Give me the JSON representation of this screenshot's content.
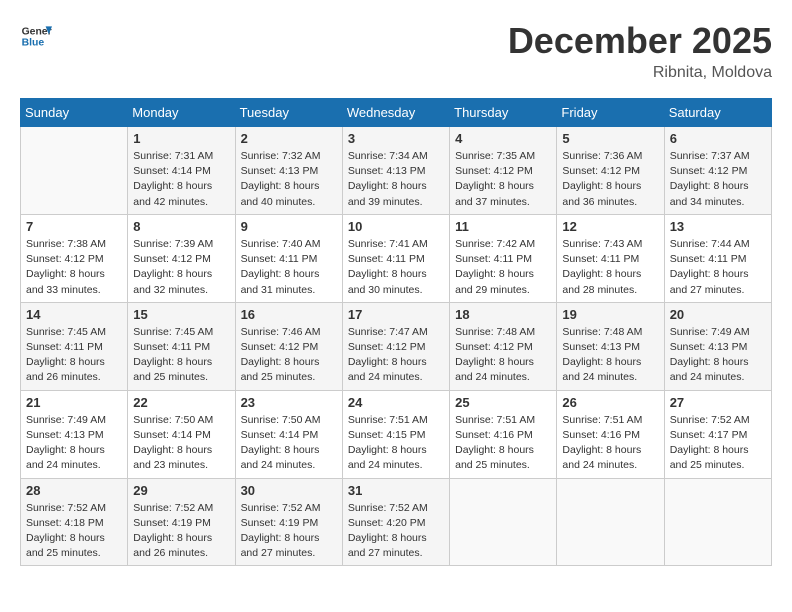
{
  "header": {
    "logo_line1": "General",
    "logo_line2": "Blue",
    "month_year": "December 2025",
    "location": "Ribnita, Moldova"
  },
  "weekdays": [
    "Sunday",
    "Monday",
    "Tuesday",
    "Wednesday",
    "Thursday",
    "Friday",
    "Saturday"
  ],
  "weeks": [
    [
      {
        "day": "",
        "sunrise": "",
        "sunset": "",
        "daylight": ""
      },
      {
        "day": "1",
        "sunrise": "Sunrise: 7:31 AM",
        "sunset": "Sunset: 4:14 PM",
        "daylight": "Daylight: 8 hours and 42 minutes."
      },
      {
        "day": "2",
        "sunrise": "Sunrise: 7:32 AM",
        "sunset": "Sunset: 4:13 PM",
        "daylight": "Daylight: 8 hours and 40 minutes."
      },
      {
        "day": "3",
        "sunrise": "Sunrise: 7:34 AM",
        "sunset": "Sunset: 4:13 PM",
        "daylight": "Daylight: 8 hours and 39 minutes."
      },
      {
        "day": "4",
        "sunrise": "Sunrise: 7:35 AM",
        "sunset": "Sunset: 4:12 PM",
        "daylight": "Daylight: 8 hours and 37 minutes."
      },
      {
        "day": "5",
        "sunrise": "Sunrise: 7:36 AM",
        "sunset": "Sunset: 4:12 PM",
        "daylight": "Daylight: 8 hours and 36 minutes."
      },
      {
        "day": "6",
        "sunrise": "Sunrise: 7:37 AM",
        "sunset": "Sunset: 4:12 PM",
        "daylight": "Daylight: 8 hours and 34 minutes."
      }
    ],
    [
      {
        "day": "7",
        "sunrise": "Sunrise: 7:38 AM",
        "sunset": "Sunset: 4:12 PM",
        "daylight": "Daylight: 8 hours and 33 minutes."
      },
      {
        "day": "8",
        "sunrise": "Sunrise: 7:39 AM",
        "sunset": "Sunset: 4:12 PM",
        "daylight": "Daylight: 8 hours and 32 minutes."
      },
      {
        "day": "9",
        "sunrise": "Sunrise: 7:40 AM",
        "sunset": "Sunset: 4:11 PM",
        "daylight": "Daylight: 8 hours and 31 minutes."
      },
      {
        "day": "10",
        "sunrise": "Sunrise: 7:41 AM",
        "sunset": "Sunset: 4:11 PM",
        "daylight": "Daylight: 8 hours and 30 minutes."
      },
      {
        "day": "11",
        "sunrise": "Sunrise: 7:42 AM",
        "sunset": "Sunset: 4:11 PM",
        "daylight": "Daylight: 8 hours and 29 minutes."
      },
      {
        "day": "12",
        "sunrise": "Sunrise: 7:43 AM",
        "sunset": "Sunset: 4:11 PM",
        "daylight": "Daylight: 8 hours and 28 minutes."
      },
      {
        "day": "13",
        "sunrise": "Sunrise: 7:44 AM",
        "sunset": "Sunset: 4:11 PM",
        "daylight": "Daylight: 8 hours and 27 minutes."
      }
    ],
    [
      {
        "day": "14",
        "sunrise": "Sunrise: 7:45 AM",
        "sunset": "Sunset: 4:11 PM",
        "daylight": "Daylight: 8 hours and 26 minutes."
      },
      {
        "day": "15",
        "sunrise": "Sunrise: 7:45 AM",
        "sunset": "Sunset: 4:11 PM",
        "daylight": "Daylight: 8 hours and 25 minutes."
      },
      {
        "day": "16",
        "sunrise": "Sunrise: 7:46 AM",
        "sunset": "Sunset: 4:12 PM",
        "daylight": "Daylight: 8 hours and 25 minutes."
      },
      {
        "day": "17",
        "sunrise": "Sunrise: 7:47 AM",
        "sunset": "Sunset: 4:12 PM",
        "daylight": "Daylight: 8 hours and 24 minutes."
      },
      {
        "day": "18",
        "sunrise": "Sunrise: 7:48 AM",
        "sunset": "Sunset: 4:12 PM",
        "daylight": "Daylight: 8 hours and 24 minutes."
      },
      {
        "day": "19",
        "sunrise": "Sunrise: 7:48 AM",
        "sunset": "Sunset: 4:13 PM",
        "daylight": "Daylight: 8 hours and 24 minutes."
      },
      {
        "day": "20",
        "sunrise": "Sunrise: 7:49 AM",
        "sunset": "Sunset: 4:13 PM",
        "daylight": "Daylight: 8 hours and 24 minutes."
      }
    ],
    [
      {
        "day": "21",
        "sunrise": "Sunrise: 7:49 AM",
        "sunset": "Sunset: 4:13 PM",
        "daylight": "Daylight: 8 hours and 24 minutes."
      },
      {
        "day": "22",
        "sunrise": "Sunrise: 7:50 AM",
        "sunset": "Sunset: 4:14 PM",
        "daylight": "Daylight: 8 hours and 23 minutes."
      },
      {
        "day": "23",
        "sunrise": "Sunrise: 7:50 AM",
        "sunset": "Sunset: 4:14 PM",
        "daylight": "Daylight: 8 hours and 24 minutes."
      },
      {
        "day": "24",
        "sunrise": "Sunrise: 7:51 AM",
        "sunset": "Sunset: 4:15 PM",
        "daylight": "Daylight: 8 hours and 24 minutes."
      },
      {
        "day": "25",
        "sunrise": "Sunrise: 7:51 AM",
        "sunset": "Sunset: 4:16 PM",
        "daylight": "Daylight: 8 hours and 25 minutes."
      },
      {
        "day": "26",
        "sunrise": "Sunrise: 7:51 AM",
        "sunset": "Sunset: 4:16 PM",
        "daylight": "Daylight: 8 hours and 24 minutes."
      },
      {
        "day": "27",
        "sunrise": "Sunrise: 7:52 AM",
        "sunset": "Sunset: 4:17 PM",
        "daylight": "Daylight: 8 hours and 25 minutes."
      }
    ],
    [
      {
        "day": "28",
        "sunrise": "Sunrise: 7:52 AM",
        "sunset": "Sunset: 4:18 PM",
        "daylight": "Daylight: 8 hours and 25 minutes."
      },
      {
        "day": "29",
        "sunrise": "Sunrise: 7:52 AM",
        "sunset": "Sunset: 4:19 PM",
        "daylight": "Daylight: 8 hours and 26 minutes."
      },
      {
        "day": "30",
        "sunrise": "Sunrise: 7:52 AM",
        "sunset": "Sunset: 4:19 PM",
        "daylight": "Daylight: 8 hours and 27 minutes."
      },
      {
        "day": "31",
        "sunrise": "Sunrise: 7:52 AM",
        "sunset": "Sunset: 4:20 PM",
        "daylight": "Daylight: 8 hours and 27 minutes."
      },
      {
        "day": "",
        "sunrise": "",
        "sunset": "",
        "daylight": ""
      },
      {
        "day": "",
        "sunrise": "",
        "sunset": "",
        "daylight": ""
      },
      {
        "day": "",
        "sunrise": "",
        "sunset": "",
        "daylight": ""
      }
    ]
  ]
}
